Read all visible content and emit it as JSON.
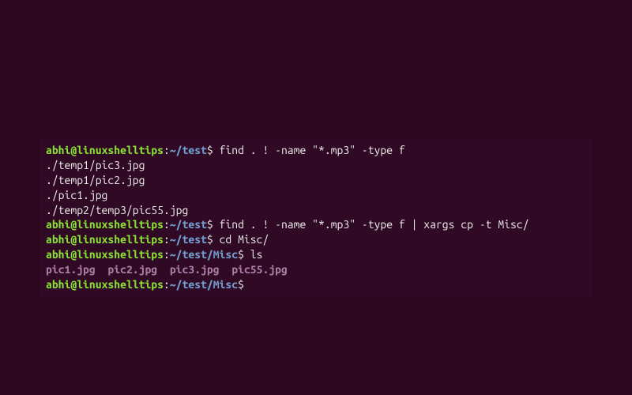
{
  "prompt": {
    "user": "abhi",
    "at": "@",
    "host": "linuxshelltips",
    "colon": ":",
    "dollar": "$ "
  },
  "paths": {
    "test": "~/test",
    "misc": "~/test/Misc"
  },
  "commands": {
    "find1": "find . ! -name \"*.mp3\" -type f",
    "find2": "find . ! -name \"*.mp3\" -type f | xargs cp -t Misc/",
    "cd": "cd Misc/",
    "ls": "ls"
  },
  "output": {
    "find_result_1": "./temp1/pic3.jpg",
    "find_result_2": "./temp1/pic2.jpg",
    "find_result_3": "./pic1.jpg",
    "find_result_4": "./temp2/temp3/pic55.jpg"
  },
  "ls_files": {
    "f1": "pic1.jpg",
    "f2": "pic2.jpg",
    "f3": "pic3.jpg",
    "f4": "pic55.jpg"
  },
  "sep": "  "
}
